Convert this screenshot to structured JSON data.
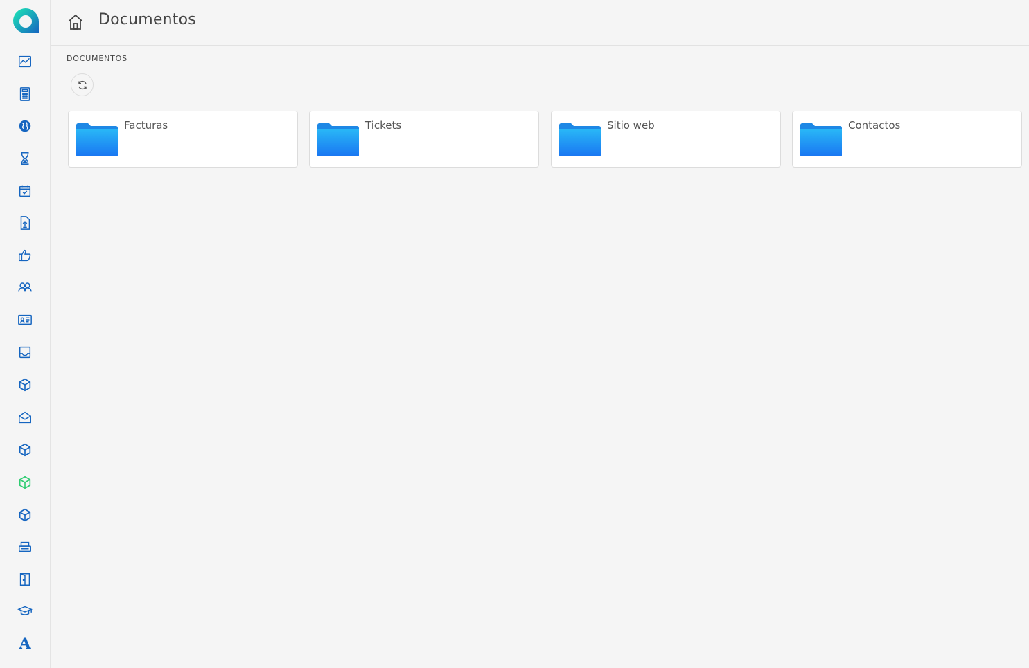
{
  "header": {
    "title": "Documentos"
  },
  "section": {
    "label": "DOCUMENTOS"
  },
  "folders": [
    {
      "name": "Facturas"
    },
    {
      "name": "Tickets"
    },
    {
      "name": "Sitio web"
    },
    {
      "name": "Contactos"
    }
  ],
  "sidebar": {
    "letter_item": "A"
  },
  "colors": {
    "accent": "#1565c0",
    "highlight": "#2ecc71",
    "folder": "#1e90ff"
  }
}
